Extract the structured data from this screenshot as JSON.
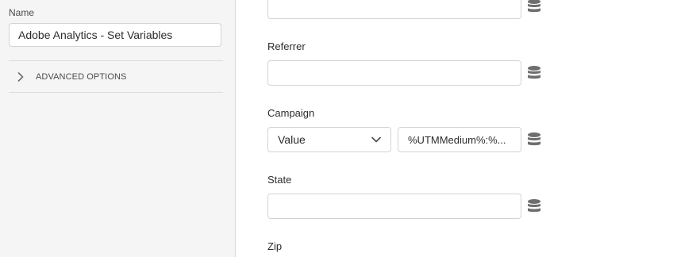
{
  "sidebar": {
    "name_label": "Name",
    "name_value": "Adobe Analytics - Set Variables",
    "advanced_options_label": "ADVANCED OPTIONS"
  },
  "form": {
    "referrer": {
      "label": "Referrer",
      "value": ""
    },
    "campaign": {
      "label": "Campaign",
      "type_selected": "Value",
      "value": "%UTMMedium%:%..."
    },
    "state": {
      "label": "State",
      "value": ""
    },
    "zip": {
      "label": "Zip"
    }
  },
  "icons": {
    "data_element": "database-icon",
    "chevron_right": "chevron-right-icon",
    "chevron_down": "chevron-down-icon"
  },
  "colors": {
    "sidebar_bg": "#f5f5f5",
    "border": "#d3d3d3",
    "icon": "#6e6e6e",
    "text": "#2c2c2c"
  }
}
